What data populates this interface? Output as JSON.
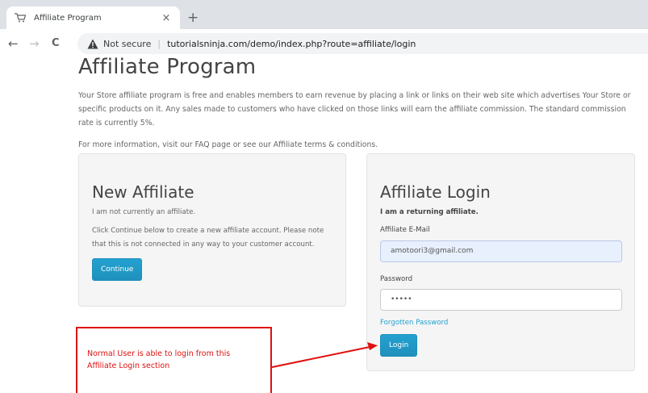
{
  "browser": {
    "tab_title": "Affiliate Program",
    "tab_close": "×",
    "new_tab": "+",
    "back": "←",
    "forward": "→",
    "reload": "C",
    "security_text": "Not secure",
    "separator": "|",
    "url": "tutorialsninja.com/demo/index.php?route=affiliate/login"
  },
  "page": {
    "title": "Affiliate Program",
    "intro": "Your Store affiliate program is free and enables members to earn revenue by placing a link or links on their web site which advertises Your Store or specific products on it. Any sales made to customers who have clicked on those links will earn the affiliate commission. The standard commission rate is currently 5%.",
    "more_info": "For more information, visit our FAQ page or see our Affiliate terms & conditions."
  },
  "new_affiliate": {
    "heading": "New Affiliate",
    "status": "I am not currently an affiliate.",
    "description": "Click Continue below to create a new affiliate account. Please note that this is not connected in any way to your customer account.",
    "continue_label": "Continue"
  },
  "login": {
    "heading": "Affiliate Login",
    "subheading": "I am a returning affiliate.",
    "email_label": "Affiliate E-Mail",
    "email_value": "amotoori3@gmail.com",
    "password_label": "Password",
    "password_value": "•••••",
    "forgot_label": "Forgotten Password",
    "login_label": "Login"
  },
  "annotation": {
    "text": "Normal User is able to login from this Affiliate Login section",
    "color": "#e01010"
  }
}
